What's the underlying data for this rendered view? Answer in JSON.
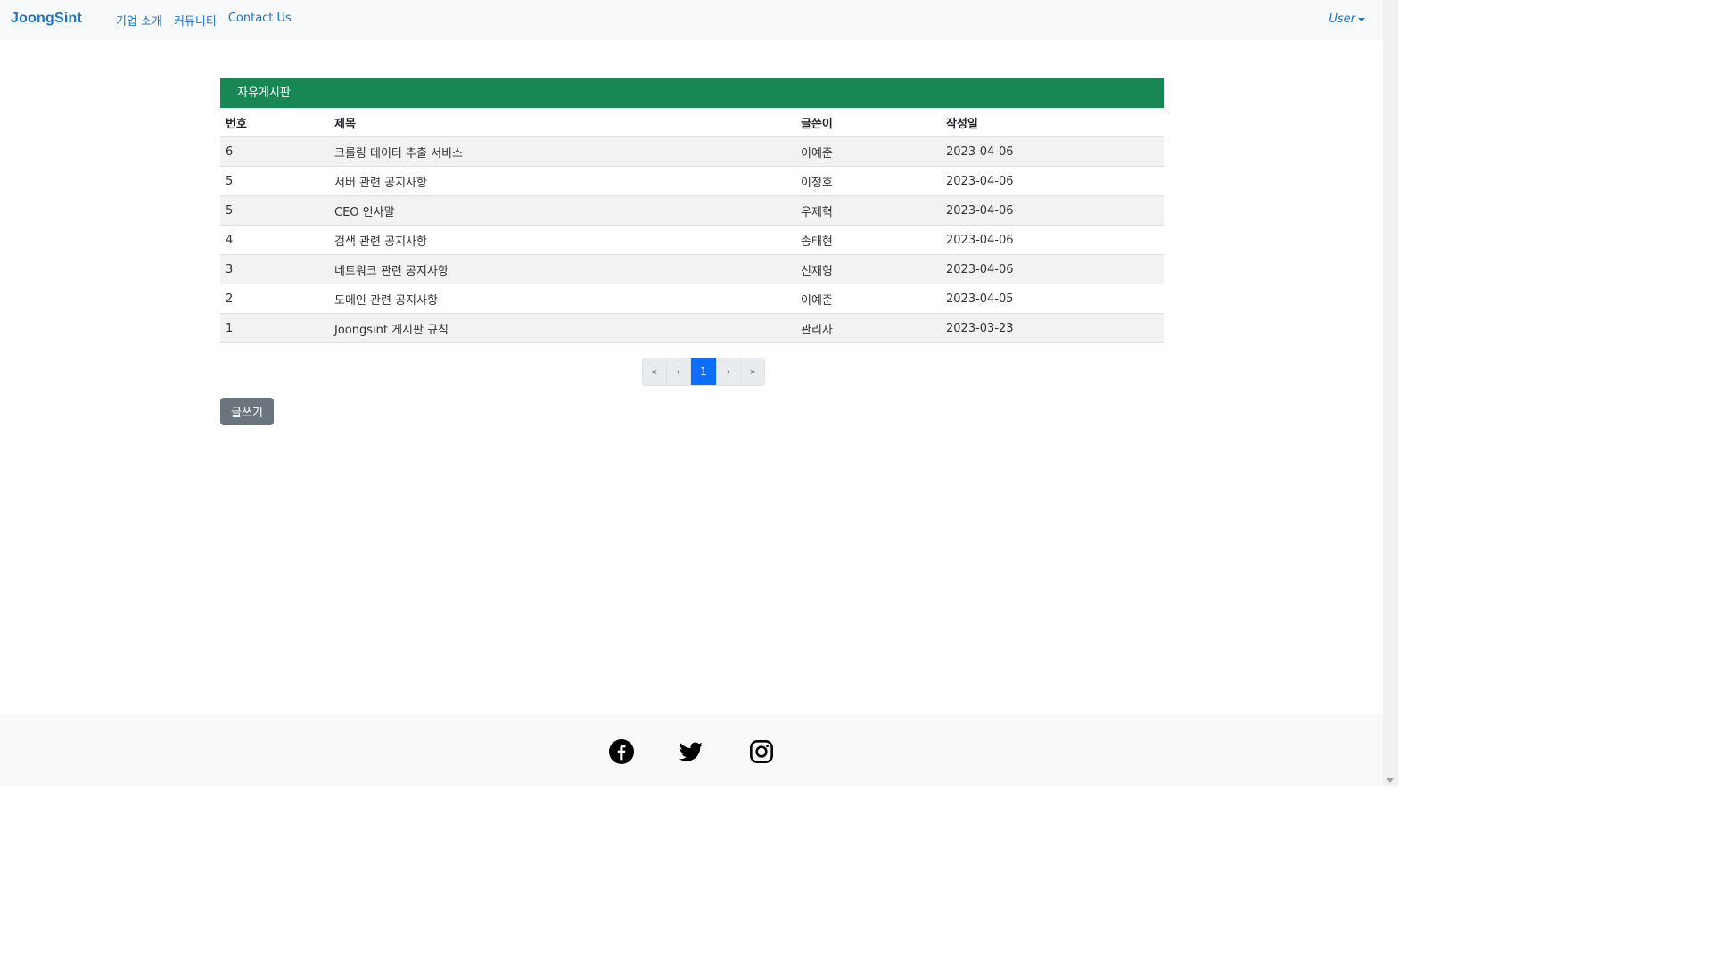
{
  "navbar": {
    "brand": "JoongSint",
    "links": [
      "기업 소개",
      "커뮤니티",
      "Contact Us"
    ],
    "user": "User"
  },
  "board": {
    "title": "자유게시판",
    "columns": [
      "번호",
      "제목",
      "글쓴이",
      "작성일"
    ],
    "rows": [
      {
        "num": "6",
        "title": "크롤링 데이터 추출 서비스",
        "writer": "이예준",
        "date": "2023-04-06"
      },
      {
        "num": "5",
        "title": "서버 관련 공지사항",
        "writer": "이정호",
        "date": "2023-04-06"
      },
      {
        "num": "5",
        "title": "CEO 인사말",
        "writer": "우제혁",
        "date": "2023-04-06"
      },
      {
        "num": "4",
        "title": "검색 관련 공지사항",
        "writer": "송태현",
        "date": "2023-04-06"
      },
      {
        "num": "3",
        "title": "네트워크 관련 공지사항",
        "writer": "신재형",
        "date": "2023-04-06"
      },
      {
        "num": "2",
        "title": "도메인 관련 공지사항",
        "writer": "이예준",
        "date": "2023-04-05"
      },
      {
        "num": "1",
        "title": "Joongsint 게시판 규칙",
        "writer": "관리자",
        "date": "2023-03-23"
      }
    ]
  },
  "pagination": {
    "first": "«",
    "prev": "‹",
    "current": "1",
    "next": "›",
    "last": "»"
  },
  "write_button": "글쓰기",
  "footer": {
    "icons": [
      "facebook-icon",
      "twitter-icon",
      "instagram-icon"
    ]
  },
  "colors": {
    "brand": "#1f73c8",
    "board_header": "#198754",
    "active_page": "#0d6efd",
    "button": "#6c757d"
  }
}
